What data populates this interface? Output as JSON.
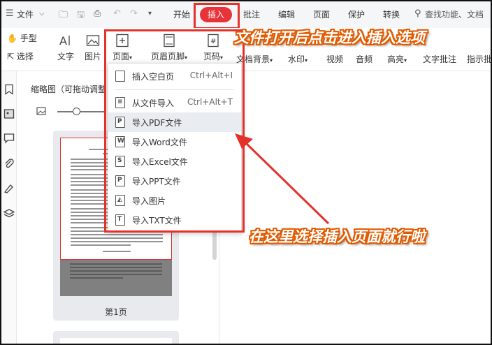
{
  "menubar": {
    "file": "文件",
    "tabs": [
      "开始",
      "插入",
      "批注",
      "编辑",
      "页面",
      "保护",
      "转换"
    ],
    "active_tab": "插入",
    "search": "查找功能、文档"
  },
  "ribbon": {
    "hand": "手型",
    "select": "选择",
    "text": "文字",
    "image": "图片",
    "page": "页面",
    "header_footer": "页眉页脚",
    "page_number": "页码",
    "doc_background": "文档背景",
    "watermark": "水印",
    "video": "视频",
    "audio": "音频",
    "highlight": "高亮",
    "text_comment": "文字批注",
    "indicator": "指示批"
  },
  "thumbnail": {
    "title": "缩略图（可拖动调整",
    "page_label": "第1页"
  },
  "dropdown": {
    "items": [
      {
        "label": "插入空白页",
        "shortcut": "Ctrl+Alt+I"
      },
      {
        "label": "从文件导入",
        "shortcut": "Ctrl+Alt+T"
      },
      {
        "label": "导入PDF文件",
        "shortcut": ""
      },
      {
        "label": "导入Word文件",
        "shortcut": ""
      },
      {
        "label": "导入Excel文件",
        "shortcut": ""
      },
      {
        "label": "导入PPT文件",
        "shortcut": ""
      },
      {
        "label": "导入图片",
        "shortcut": ""
      },
      {
        "label": "导入TXT文件",
        "shortcut": ""
      }
    ],
    "highlighted_index": 2
  },
  "annotations": {
    "top": "文件打开后点击进入插入选项",
    "bottom": "在这里选择插入页面就行啦"
  },
  "colors": {
    "accent": "#e8333a",
    "highlight_box": "#e4322b",
    "annotation_outline": "#e25b00"
  }
}
